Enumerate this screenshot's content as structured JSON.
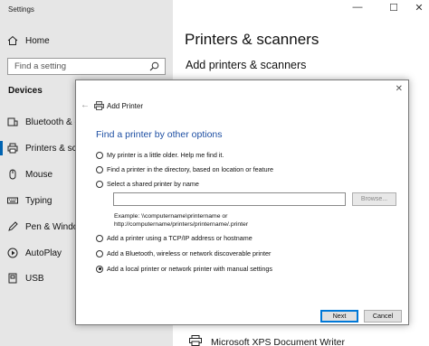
{
  "window": {
    "title": "Settings",
    "controls": [
      "—",
      "☐",
      "✕"
    ]
  },
  "sidebar": {
    "home_label": "Home",
    "search_placeholder": "Find a setting",
    "section_label": "Devices",
    "items": [
      {
        "label": "Bluetooth & o",
        "icon": "bluetooth-icon"
      },
      {
        "label": "Printers & scan",
        "icon": "printer-icon"
      },
      {
        "label": "Mouse",
        "icon": "mouse-icon"
      },
      {
        "label": "Typing",
        "icon": "keyboard-icon"
      },
      {
        "label": "Pen & Window",
        "icon": "pen-icon"
      },
      {
        "label": "AutoPlay",
        "icon": "autoplay-icon"
      },
      {
        "label": "USB",
        "icon": "usb-icon"
      }
    ]
  },
  "main": {
    "title": "Printers & scanners",
    "subtitle": "Add printers & scanners",
    "printer_item": "Microsoft XPS Document Writer"
  },
  "dialog": {
    "title": "Add Printer",
    "heading": "Find a printer by other options",
    "options": [
      {
        "label": "My printer is a little older. Help me find it.",
        "selected": false
      },
      {
        "label": "Find a printer in the directory, based on location or feature",
        "selected": false
      },
      {
        "label": "Select a shared printer by name",
        "selected": false
      },
      {
        "label": "Add a printer using a TCP/IP address or hostname",
        "selected": false
      },
      {
        "label": "Add a Bluetooth, wireless or network discoverable printer",
        "selected": false
      },
      {
        "label": "Add a local printer or network printer with manual settings",
        "selected": true
      }
    ],
    "shared_name_value": "",
    "browse_label": "Browse...",
    "example_line1": "Example: \\\\computername\\printername or",
    "example_line2": "http://computername/printers/printername/.printer",
    "next_label": "Next",
    "cancel_label": "Cancel"
  },
  "colors": {
    "accent": "#0063b1",
    "heading_blue": "#1e4fa3",
    "sidebar_bg": "#e6e6e6"
  }
}
